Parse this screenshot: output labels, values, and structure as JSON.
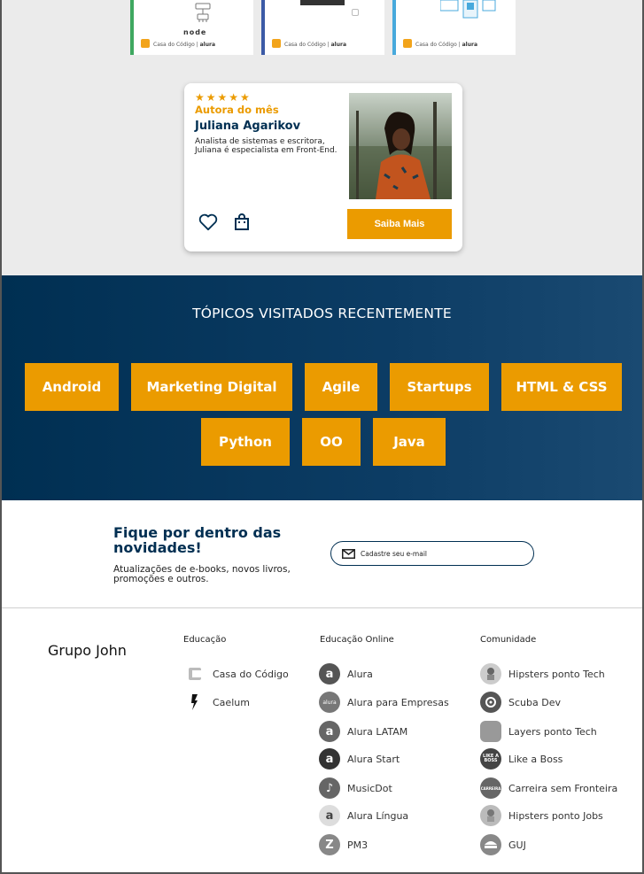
{
  "covers": [
    {
      "accent": "#3fa860",
      "art_text": "node",
      "brand_left": "Casa do Código",
      "brand_right": "alura"
    },
    {
      "accent": "#3c5aa6",
      "art_text": "",
      "brand_left": "Casa do Código",
      "brand_right": "alura"
    },
    {
      "accent": "#48a9dc",
      "art_text": "",
      "brand_left": "Casa do Código",
      "brand_right": "alura"
    }
  ],
  "author": {
    "stars": "★★★★★",
    "tag": "Autora do mês",
    "name": "Juliana Agarikov",
    "bio": "Analista de sistemas e escritora, Juliana é especialista em Front-End.",
    "cta_label": "Saiba Mais",
    "icons": {
      "favorite": "heart-icon",
      "cart": "shopping-bag-icon"
    }
  },
  "topics": {
    "title": "TÓPICOS VISITADOS RECENTEMENTE",
    "items": [
      "Android",
      "Marketing Digital",
      "Agile",
      "Startups",
      "HTML & CSS",
      "Python",
      "OO",
      "Java"
    ]
  },
  "newsletter": {
    "title": "Fique por dentro das novidades!",
    "subtitle": "Atualizações de e-books, novos livros, promoções e outros.",
    "placeholder": "Cadastre seu e-mail"
  },
  "footer": {
    "brand": "Grupo John",
    "columns": [
      {
        "title": "Educação",
        "items": [
          "Casa do Código",
          "Caelum"
        ]
      },
      {
        "title": "Educação Online",
        "items": [
          "Alura",
          "Alura para Empresas",
          "Alura LATAM",
          "Alura Start",
          "MusicDot",
          "Alura Língua",
          "PM3"
        ]
      },
      {
        "title": "Comunidade",
        "items": [
          "Hipsters ponto Tech",
          "Scuba Dev",
          "Layers ponto Tech",
          "Like a Boss",
          "Carreira sem Fronteira",
          "Hipsters ponto Jobs",
          "GUJ"
        ]
      }
    ]
  },
  "colors": {
    "accent": "#eb9b00",
    "navy": "#002f52"
  }
}
